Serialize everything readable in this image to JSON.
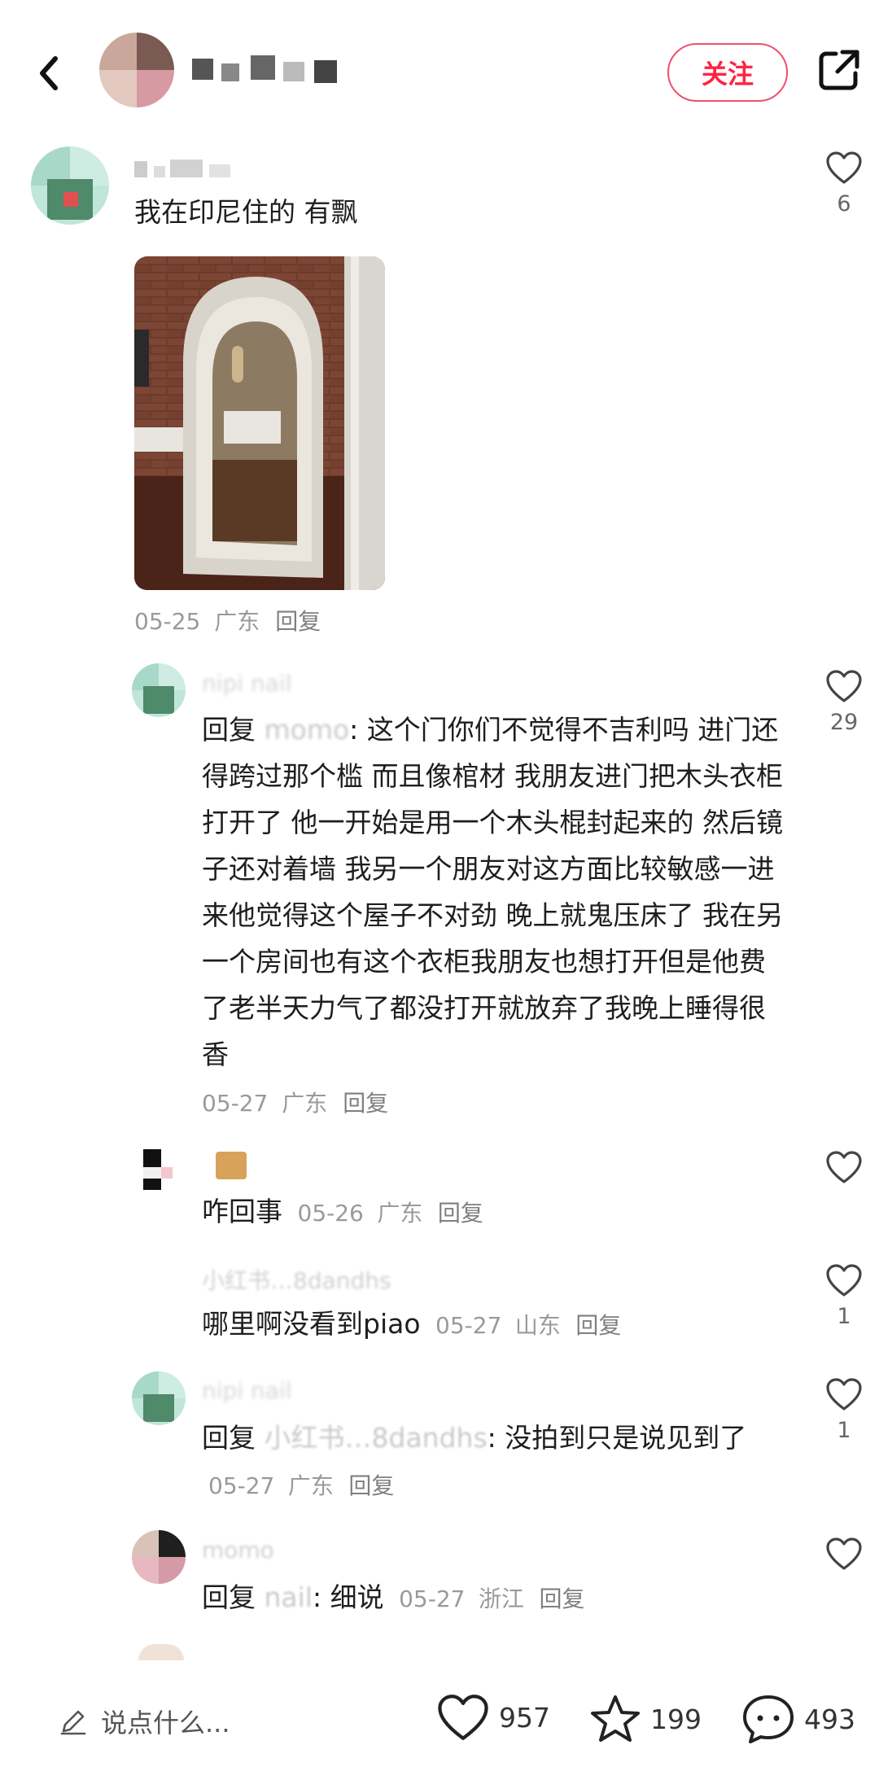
{
  "header": {
    "follow_label": "关注"
  },
  "comments": [
    {
      "text": "我在印尼住的 有飘",
      "date": "05-25",
      "location": "广东",
      "reply_label": "回复",
      "likes": "6"
    },
    {
      "reply_prefix": "回复",
      "mention": "momo",
      "text": ": 这个门你们不觉得不吉利吗 进门还得跨过那个槛 而且像棺材 我朋友进门把木头衣柜打开了 他一开始是用一个木头棍封起来的 然后镜子还对着墙 我另一个朋友对这方面比较敏感一进来他觉得这个屋子不对劲 晚上就鬼压床了 我在另一个房间也有这个衣柜我朋友也想打开但是他费了老半天力气了都没打开就放弃了我晚上睡得很香",
      "date": "05-27",
      "location": "广东",
      "reply_label": "回复",
      "likes": "29"
    },
    {
      "text": "咋回事",
      "date": "05-26",
      "location": "广东",
      "reply_label": "回复",
      "likes": ""
    },
    {
      "text": "哪里啊没看到piao",
      "date": "05-27",
      "location": "山东",
      "reply_label": "回复",
      "likes": "1"
    },
    {
      "reply_prefix": "回复",
      "mention": "小红书…8dandhs",
      "text": ": 没拍到只是说见到了",
      "date": "05-27",
      "location": "广东",
      "reply_label": "回复",
      "likes": "1"
    },
    {
      "reply_prefix": "回复",
      "mention": "nail",
      "text": ": 细说",
      "date": "05-27",
      "location": "浙江",
      "reply_label": "回复",
      "likes": ""
    }
  ],
  "blurred_names": {
    "c2": "nipi nail",
    "c4": "小红书…8dandhs",
    "c5": "nipi nail",
    "c6": "momo"
  },
  "bottom": {
    "placeholder": "说点什么...",
    "likes": "957",
    "stars": "199",
    "comments": "493"
  },
  "colors": {
    "accent": "#ff2442",
    "meta": "#9a9a9a"
  },
  "icons": [
    "back-arrow-icon",
    "share-icon",
    "heart-icon",
    "star-icon",
    "comment-bubble-icon",
    "pencil-icon"
  ]
}
